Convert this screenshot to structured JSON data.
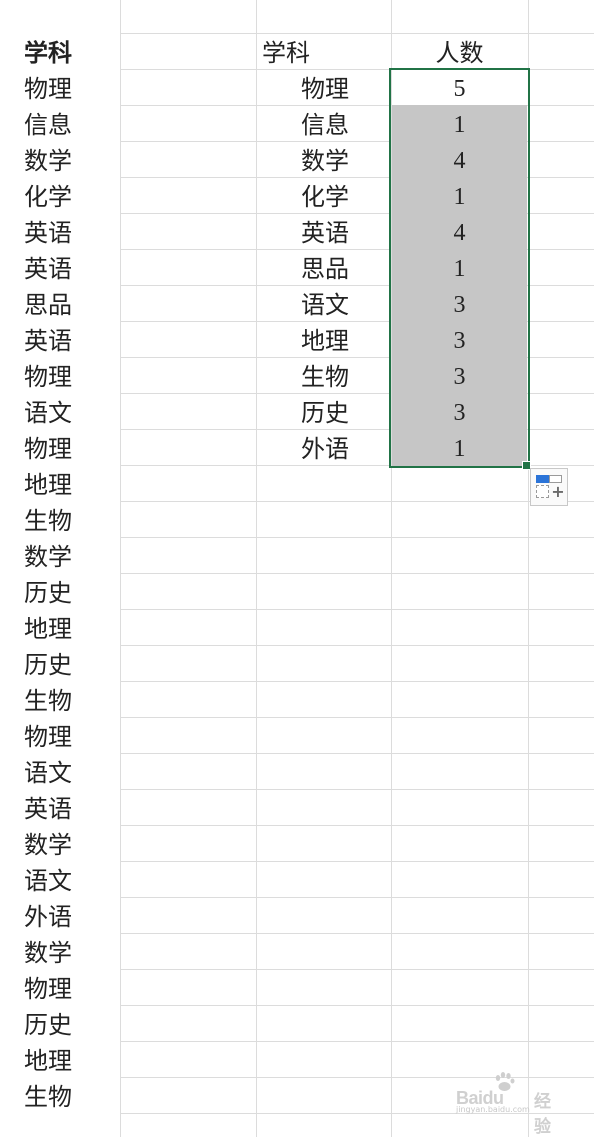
{
  "sheet": {
    "column_a": {
      "header": "学科",
      "values": [
        "物理",
        "信息",
        "数学",
        "化学",
        "英语",
        "英语",
        "思品",
        "英语",
        "物理",
        "语文",
        "物理",
        "地理",
        "生物",
        "数学",
        "历史",
        "地理",
        "历史",
        "生物",
        "物理",
        "语文",
        "英语",
        "数学",
        "语文",
        "外语",
        "数学",
        "物理",
        "历史",
        "地理",
        "生物"
      ]
    },
    "summary": {
      "subject_header": "学科",
      "count_header": "人数",
      "rows": [
        {
          "subject": "物理",
          "count": "5"
        },
        {
          "subject": "信息",
          "count": "1"
        },
        {
          "subject": "数学",
          "count": "4"
        },
        {
          "subject": "化学",
          "count": "1"
        },
        {
          "subject": "英语",
          "count": "4"
        },
        {
          "subject": "思品",
          "count": "1"
        },
        {
          "subject": "语文",
          "count": "3"
        },
        {
          "subject": "地理",
          "count": "3"
        },
        {
          "subject": "生物",
          "count": "3"
        },
        {
          "subject": "历史",
          "count": "3"
        },
        {
          "subject": "外语",
          "count": "1"
        }
      ]
    }
  },
  "colors": {
    "selection_border": "#217346",
    "selection_shade": "#c6c6c6",
    "gridline": "#dcdcdc"
  },
  "icons": {
    "quick_analysis": "quick-analysis-icon",
    "fill_handle": "fill-handle-icon"
  },
  "watermark": {
    "brand": "Baidu",
    "brand_cn": "经验",
    "url": "jingyan.baidu.com"
  }
}
